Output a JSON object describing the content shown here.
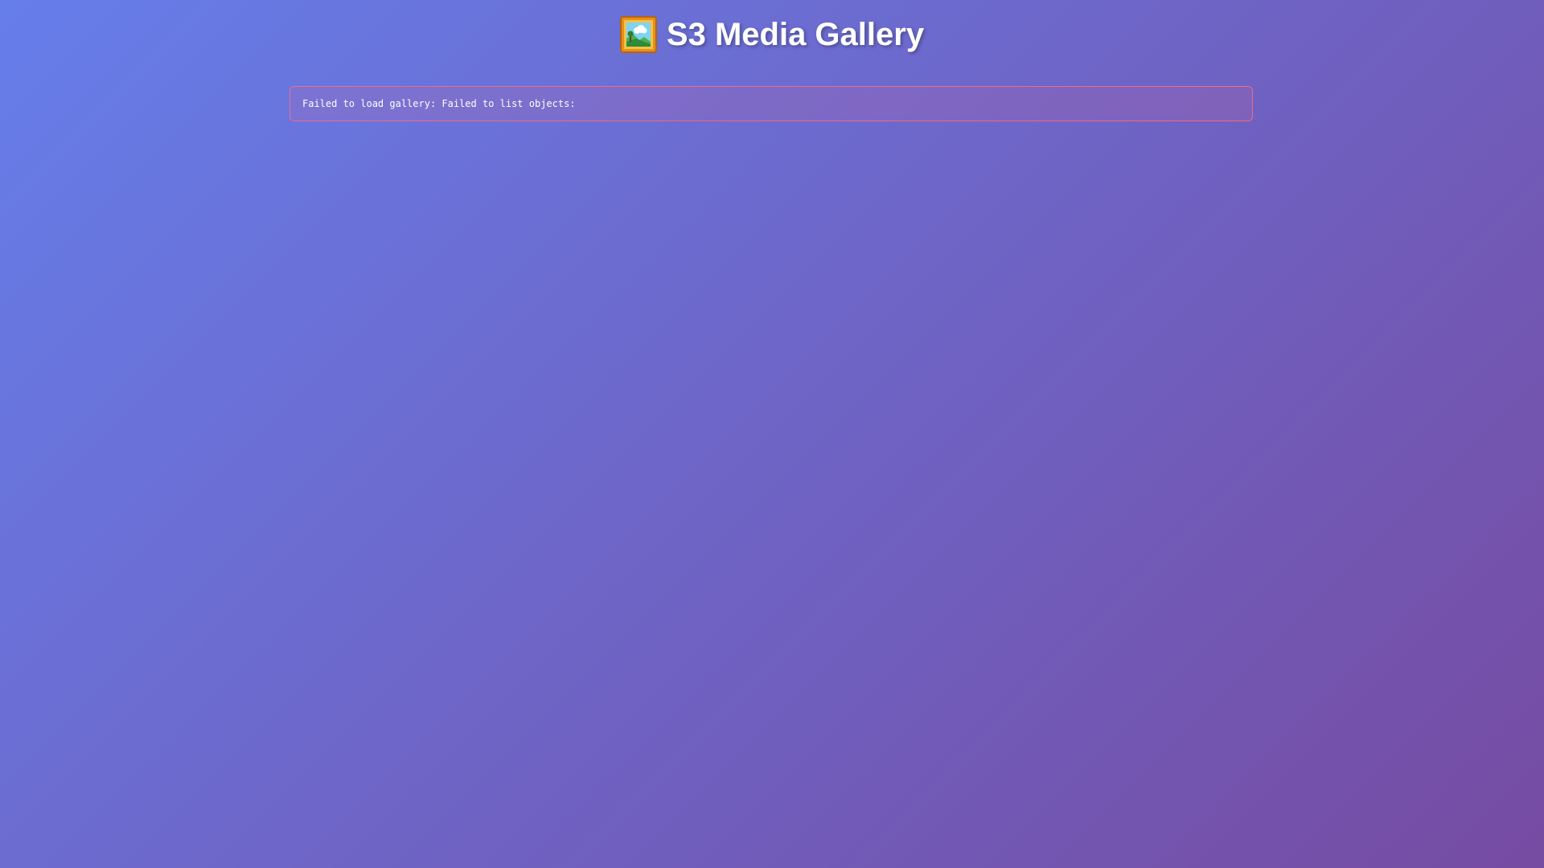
{
  "header": {
    "title": "S3 Media Gallery",
    "icon": "framed-picture-icon"
  },
  "error": {
    "message": "Failed to load gallery: Failed to list objects:"
  },
  "colors": {
    "background_start": "#667eea",
    "background_end": "#764ba2",
    "error_border": "#ff6b81",
    "text": "#ffffff"
  }
}
